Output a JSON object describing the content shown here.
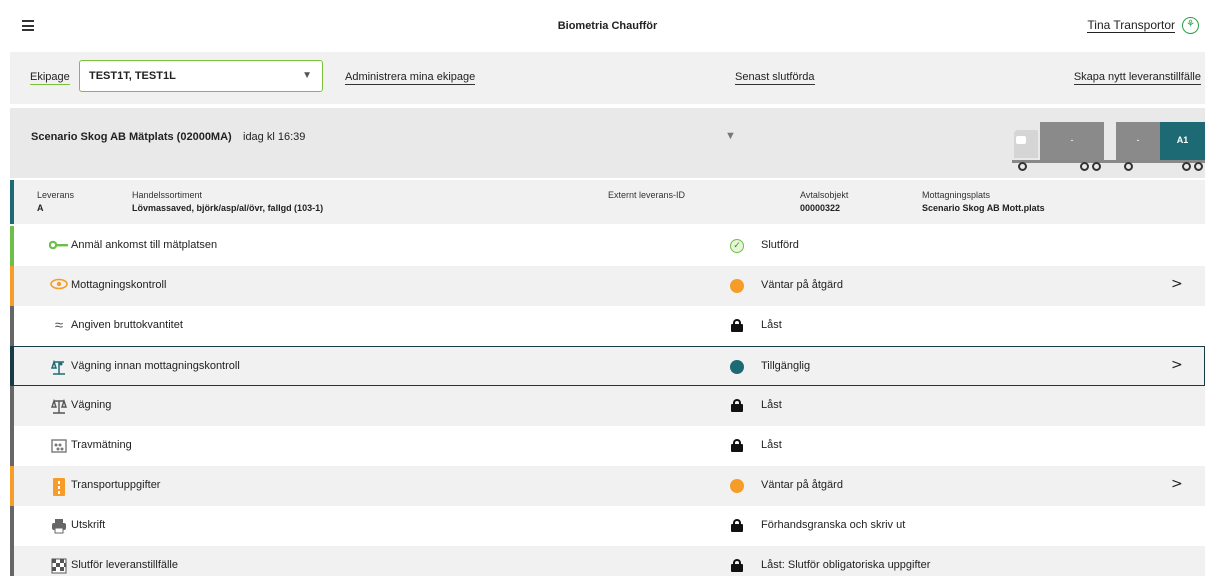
{
  "header": {
    "app_title": "Biometria Chaufför",
    "user_name": "Tina Transportor"
  },
  "ekipage_bar": {
    "label": "Ekipage",
    "selected_value": "TEST1T, TEST1L",
    "admin_link": "Administrera mina ekipage",
    "recent_link": "Senast slutförda",
    "create_link": "Skapa nytt leveranstillfälle"
  },
  "delivery": {
    "place": "Scenario Skog AB Mätplats (02000MA)",
    "time": "idag kl 16:39",
    "truck": {
      "box1": "-",
      "box2": "-",
      "box3": "A1"
    },
    "details": {
      "leverans_label": "Leverans",
      "leverans_value": "A",
      "sortiment_label": "Handelssortiment",
      "sortiment_value": "Lövmassaved, björk/asp/al/övr, fallgd (103-1)",
      "extern_label": "Externt leverans-ID",
      "extern_value": "",
      "avtal_label": "Avtalsobjekt",
      "avtal_value": "00000322",
      "mottag_label": "Mottagningsplats",
      "mottag_value": "Scenario Skog AB Mott.plats"
    }
  },
  "tasks": [
    {
      "label": "Anmäl ankomst till mätplatsen",
      "icon": "key-icon",
      "status": "Slutförd",
      "status_icon": "check-icon",
      "color": "#6cc04a"
    },
    {
      "label": "Mottagningskontroll",
      "icon": "eye-icon",
      "status": "Väntar på åtgärd",
      "status_icon": "orange-dot-icon",
      "color": "#f59d28",
      "chevron": ">"
    },
    {
      "label": "Angiven bruttokvantitet",
      "icon": "approx-icon",
      "status": "Låst",
      "status_icon": "lock-icon",
      "color": "#666666"
    },
    {
      "label": "Vägning innan mottagningskontroll",
      "icon": "scale-icon",
      "status": "Tillgänglig",
      "status_icon": "teal-dot-icon",
      "color": "#163b47",
      "chevron": ">"
    },
    {
      "label": "Vägning",
      "icon": "scale-icon",
      "status": "Låst",
      "status_icon": "lock-icon",
      "color": "#666666"
    },
    {
      "label": "Travmätning",
      "icon": "log-pile-icon",
      "status": "Låst",
      "status_icon": "lock-icon",
      "color": "#666666"
    },
    {
      "label": "Transportuppgifter",
      "icon": "document-icon",
      "status": "Väntar på åtgärd",
      "status_icon": "orange-dot-icon",
      "color": "#f59d28",
      "chevron": ">"
    },
    {
      "label": "Utskrift",
      "icon": "printer-icon",
      "status": "Förhandsgranska och skriv ut",
      "status_icon": "lock-icon",
      "color": "#666666"
    },
    {
      "label": "Slutför leveranstillfälle",
      "icon": "checkered-flag-icon",
      "status": "Låst: Slutför obligatoriska uppgifter",
      "status_icon": "lock-icon",
      "color": "#666666"
    }
  ]
}
